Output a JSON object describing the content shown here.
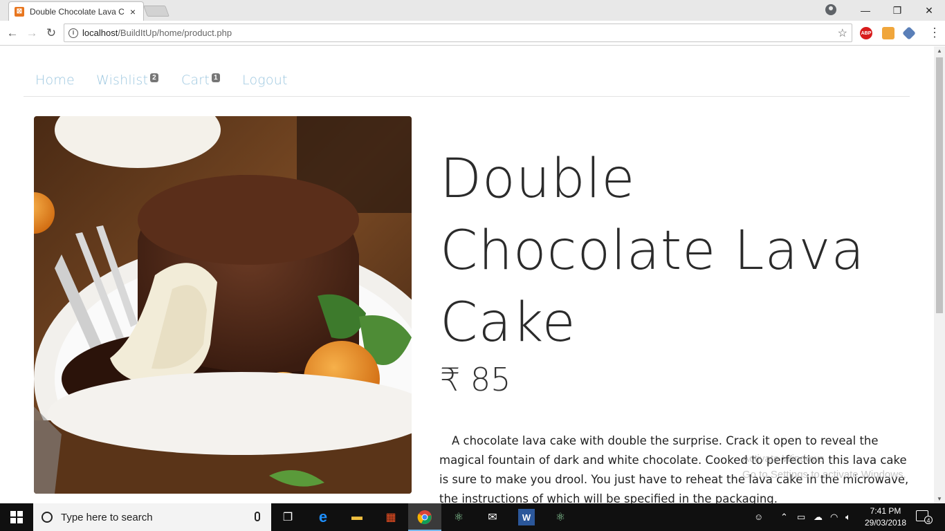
{
  "browser": {
    "tab_title": "Double Chocolate Lava C",
    "tab_close": "×",
    "url_host": "localhost",
    "url_path": "/BuildItUp/home/product.php",
    "ext_abp": "ABP",
    "window_controls": {
      "minimize": "—",
      "maximize": "❐",
      "close": "✕"
    }
  },
  "nav": {
    "home": "Home",
    "wishlist": "Wishlist",
    "wishlist_count": "2",
    "cart": "Cart",
    "cart_count": "1",
    "logout": "Logout"
  },
  "product": {
    "title": "Double Chocolate Lava Cake",
    "price": "₹ 85",
    "description": "A chocolate lava cake with double the surprise. Crack it open to reveal the magical fountain of dark and white chocolate. Cooked to perfection this lava cake is sure to make you drool. You just have to reheat the lava cake in the microwave, the instructions of which will be specified in the packaging."
  },
  "watermark": {
    "line1": "Activate Windows",
    "line2": "Go to Settings to activate Windows."
  },
  "taskbar": {
    "search_placeholder": "Type here to search",
    "time": "7:41 PM",
    "date": "29/03/2018",
    "notification_count": "4"
  },
  "colors": {
    "nav_link": "#9ec8e0",
    "badge": "#777777",
    "title_text": "#2b2b2b"
  }
}
